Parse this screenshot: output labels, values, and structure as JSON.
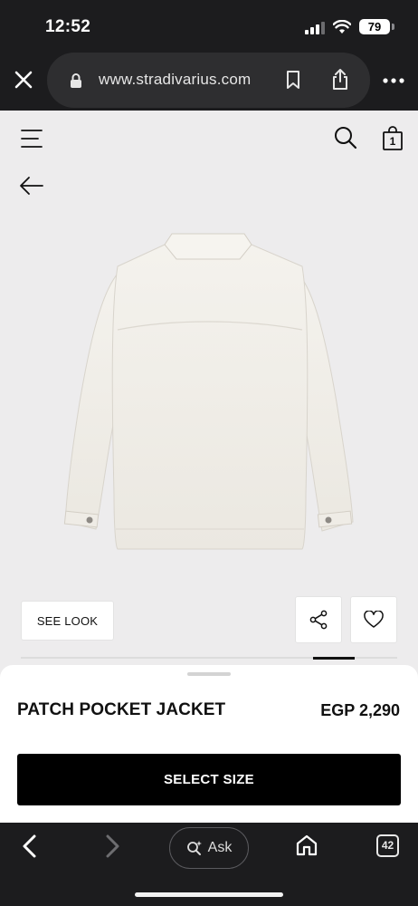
{
  "status_bar": {
    "time": "12:52",
    "battery_level": "79"
  },
  "browser": {
    "url": "www.stradivarius.com",
    "tab_count": "42",
    "ask_label": "Ask"
  },
  "site_header": {
    "bag_count": "1"
  },
  "product": {
    "image_icon": "jacket-image",
    "image_color": "#f1efea",
    "see_look_label": "SEE LOOK",
    "name": "PATCH POCKET JACKET",
    "price": "EGP 2,290",
    "select_size_label": "SELECT SIZE"
  },
  "icons": {
    "close": "close-icon",
    "lock": "lock-icon",
    "bookmark": "bookmark-icon",
    "share": "share-icon",
    "more": "more-icon",
    "menu": "hamburger-icon",
    "search": "search-icon",
    "bag": "shopping-bag-icon",
    "back": "back-arrow-icon",
    "favorite": "heart-icon",
    "home": "home-icon"
  },
  "colors": {
    "page_background": "#edeced",
    "button_black": "#000000",
    "browser_chrome": "#1c1c1e"
  }
}
